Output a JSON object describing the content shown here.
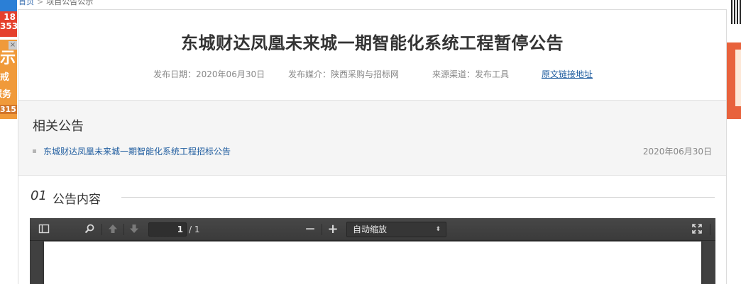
{
  "breadcrumb": {
    "home": "首页",
    "current": "项目公告公示"
  },
  "ad_left": {
    "line1": "18",
    "line2": "353",
    "big": "示",
    "line3": "戒",
    "line4": "服务",
    "line5": "315",
    "close_label": "×"
  },
  "article": {
    "title": "东城财达凤凰未来城一期智能化系统工程暂停公告",
    "publish_date_label": "发布日期：",
    "publish_date": "2020年06月30日",
    "media_label": "发布媒介：",
    "media": "陕西采购与招标网",
    "source_label": "来源渠道：",
    "source": "发布工具",
    "original_link": "原文链接地址"
  },
  "related": {
    "heading": "相关公告",
    "items": [
      {
        "title": "东城财达凤凰未来城一期智能化系统工程招标公告",
        "date": "2020年06月30日"
      }
    ]
  },
  "section": {
    "number": "01",
    "name": "公告内容"
  },
  "pdf_viewer": {
    "current_page": "1",
    "page_count": "/ 1",
    "zoom_minus": "—",
    "zoom_plus": "+",
    "zoom_value": "自动缩放",
    "zoom_caret": "⬍"
  },
  "colors": {
    "link": "#1d5b9e",
    "toolbar": "#404040",
    "related_bg": "#f5f5f5"
  }
}
